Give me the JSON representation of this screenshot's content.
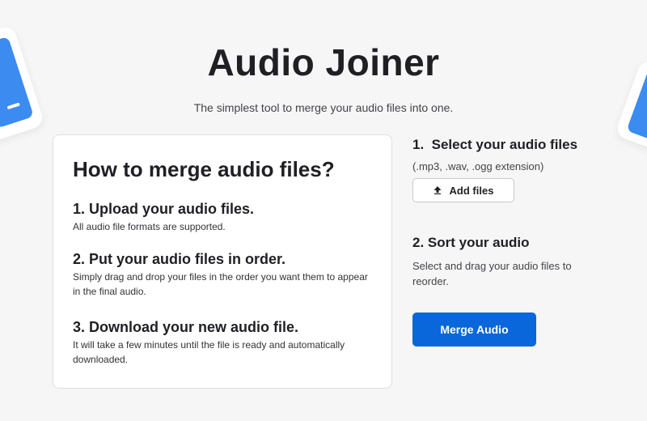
{
  "header": {
    "title": "Audio Joiner",
    "subtitle": "The simplest tool to merge your audio files into one."
  },
  "guide": {
    "heading": "How to merge audio files?",
    "steps": [
      {
        "title": "1. Upload your audio files.",
        "desc": "All audio file formats are supported."
      },
      {
        "title": "2. Put your audio files in order.",
        "desc": "Simply drag and drop your files in the order you want them to appear in the final audio."
      },
      {
        "title": "3. Download your new audio file.",
        "desc": "It will take a few minutes until the file is ready and automatically downloaded."
      }
    ]
  },
  "side": {
    "select_heading": "1.  Select your audio files",
    "select_hint": "(.mp3, .wav, .ogg extension)",
    "add_files_label": "Add files",
    "add_files_icon": "upload-icon",
    "sort_heading": "2. Sort your audio",
    "sort_desc": "Select and drag your audio files to reorder.",
    "merge_label": "Merge Audio"
  },
  "colors": {
    "accent": "#0a66db",
    "decor": "#3b8bf0",
    "background": "#f6f6f7"
  }
}
